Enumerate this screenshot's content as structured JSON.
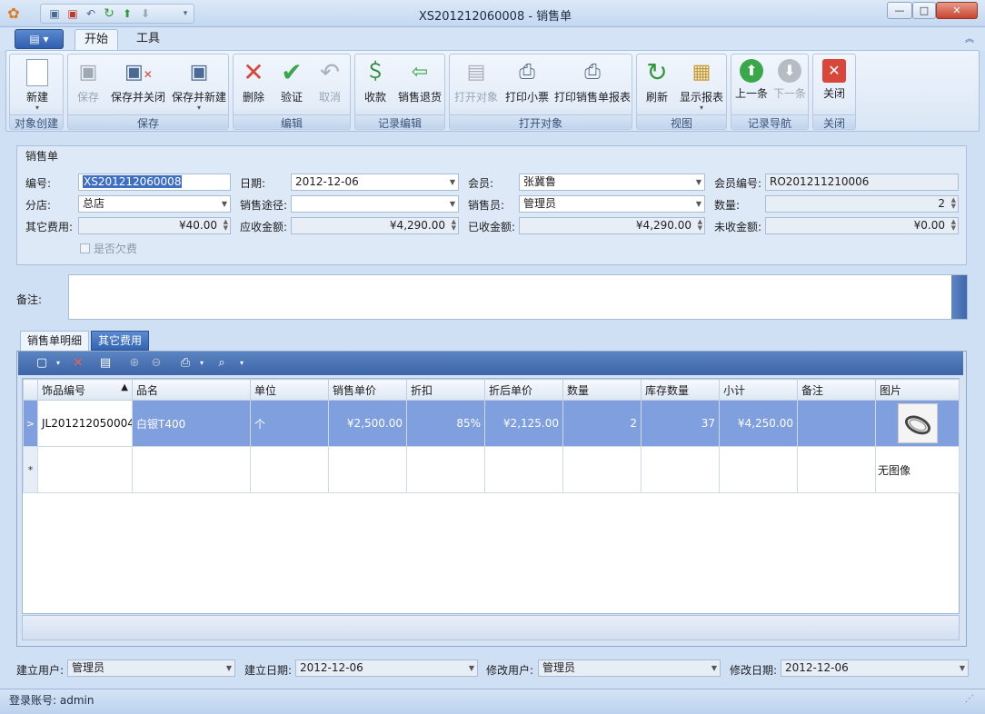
{
  "window": {
    "title": "XS201212060008 - 销售单",
    "min": "—",
    "max": "□",
    "close": "✕"
  },
  "tabs": {
    "start": "开始",
    "tools": "工具"
  },
  "ribbon": {
    "groups": {
      "create": "对象创建",
      "save": "保存",
      "edit": "编辑",
      "record_edit": "记录编辑",
      "open": "打开对象",
      "view": "视图",
      "nav": "记录导航",
      "close": "关闭"
    },
    "buttons": {
      "new": "新建",
      "save": "保存",
      "save_close": "保存并关闭",
      "save_new": "保存并新建",
      "delete": "删除",
      "validate": "验证",
      "cancel": "取消",
      "receive": "收款",
      "return": "销售退货",
      "open_obj": "打开对象",
      "print_ticket": "打印小票",
      "print_report": "打印销售单报表",
      "refresh": "刷新",
      "show_report": "显示报表",
      "prev": "上一条",
      "next": "下一条",
      "close": "关闭"
    }
  },
  "form": {
    "title": "销售单",
    "labels": {
      "number": "编号:",
      "date": "日期:",
      "member": "会员:",
      "member_no": "会员编号:",
      "branch": "分店:",
      "channel": "销售途径:",
      "salesman": "销售员:",
      "qty": "数量:",
      "other_fee": "其它费用:",
      "receivable": "应收金额:",
      "received": "已收金额:",
      "unreceived": "未收金额:",
      "owed": "是否欠费",
      "remark": "备注:"
    },
    "values": {
      "number": "XS201212060008",
      "date": "2012-12-06",
      "member": "张冀鲁",
      "member_no": "RO201211210006",
      "branch": "总店",
      "channel": "",
      "salesman": "管理员",
      "qty": "2",
      "other_fee": "¥40.00",
      "receivable": "¥4,290.00",
      "received": "¥4,290.00",
      "unreceived": "¥0.00"
    }
  },
  "detail_tabs": {
    "detail": "销售单明细",
    "fees": "其它费用"
  },
  "grid": {
    "columns": [
      "饰品编号",
      "品名",
      "单位",
      "销售单价",
      "折扣",
      "折后单价",
      "数量",
      "库存数量",
      "小计",
      "备注",
      "图片"
    ],
    "sort_indicator": "▲",
    "rows": [
      {
        "code": "JL201212050004",
        "name": "白银T400",
        "unit": "个",
        "price": "¥2,500.00",
        "discount": "85%",
        "net_price": "¥2,125.00",
        "qty": "2",
        "stock": "37",
        "subtotal": "¥4,250.00",
        "remark": ""
      }
    ],
    "new_row_image_text": "无图像",
    "current_marker": ">",
    "new_marker": "*"
  },
  "footer": {
    "labels": {
      "create_user": "建立用户:",
      "create_date": "建立日期:",
      "modify_user": "修改用户:",
      "modify_date": "修改日期:"
    },
    "values": {
      "create_user": "管理员",
      "create_date": "2012-12-06",
      "modify_user": "管理员",
      "modify_date": "2012-12-06"
    }
  },
  "status": {
    "login": "登录账号: admin"
  },
  "icons": {
    "app": "gear-icon",
    "new": "new-document-icon",
    "save": "floppy-icon",
    "delete": "red-x-icon",
    "validate": "check-icon",
    "refresh": "refresh-icon",
    "close": "close-icon"
  },
  "colors": {
    "accent": "#3d65a8",
    "selection": "#7f9fde",
    "close_red": "#d9463a",
    "check_green": "#3aa84a"
  }
}
